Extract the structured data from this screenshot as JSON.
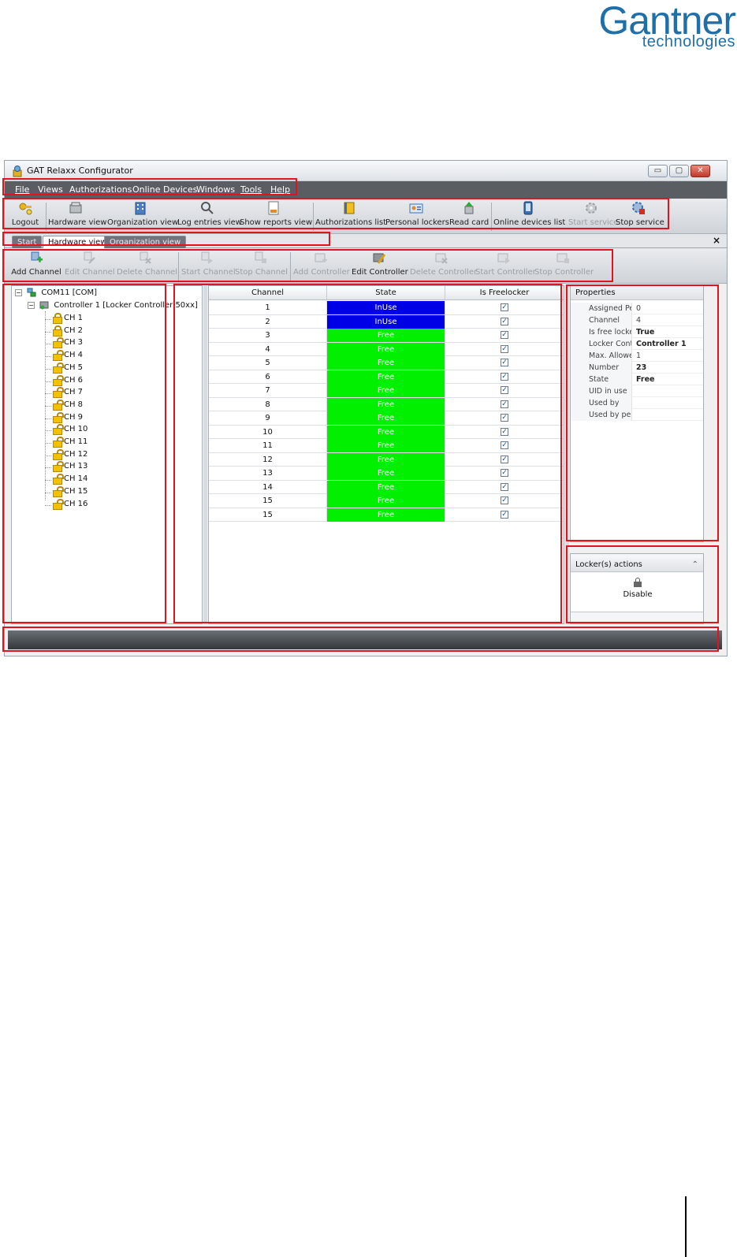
{
  "logo": {
    "word": "Gantner",
    "sub": "technologies"
  },
  "window": {
    "title": "GAT Relaxx Configurator",
    "buttons": {
      "minimize": "▭",
      "maximize": "▢",
      "close": "✕"
    }
  },
  "menu": {
    "items": [
      {
        "label": "File",
        "underline": "F"
      },
      {
        "label": "Views"
      },
      {
        "label": "Authorizations"
      },
      {
        "label": "Online Devices"
      },
      {
        "label": "Windows"
      },
      {
        "label": "Tools",
        "underline": "T"
      },
      {
        "label": "Help",
        "underline": "H"
      }
    ]
  },
  "toolbar": {
    "logout": "Logout",
    "hardware_view": "Hardware view",
    "organization_view": "Organization view",
    "log_entries_view": "Log entries view",
    "show_reports_view": "Show reports view",
    "authorizations_list": "Authorizations list",
    "personal_lockers": "Personal lockers",
    "read_card": "Read card",
    "online_devices_list": "Online devices list",
    "start_service": "Start service",
    "stop_service": "Stop service"
  },
  "tabs": {
    "start": "Start",
    "hardware_view": "Hardware view",
    "organization_view": "Organization view",
    "close": "×"
  },
  "toolbar2": {
    "add_channel": "Add Channel",
    "edit_channel": "Edit Channel",
    "delete_channel": "Delete Channel",
    "start_channel": "Start Channel",
    "stop_channel": "Stop Channel",
    "add_controller": "Add Controller",
    "edit_controller": "Edit Controller",
    "delete_controller": "Delete Controller",
    "start_controller": "Start Controller",
    "stop_controller": "Stop Controller"
  },
  "tree": {
    "root": "COM11 [COM]",
    "controller": "Controller 1 [Locker Controller 50xx]",
    "channels": [
      "CH 1",
      "CH 2",
      "CH 3",
      "CH 4",
      "CH 5",
      "CH 6",
      "CH 7",
      "CH 8",
      "CH 9",
      "CH 10",
      "CH 11",
      "CH 12",
      "CH 13",
      "CH 14",
      "CH 15",
      "CH 16"
    ],
    "expand_symbol": "−"
  },
  "grid": {
    "columns": [
      "Channel",
      "State",
      "Is Freelocker"
    ],
    "rows": [
      {
        "channel": "1",
        "state": "InUse",
        "freelocker": "✓"
      },
      {
        "channel": "2",
        "state": "InUse",
        "freelocker": "✓"
      },
      {
        "channel": "3",
        "state": "Free",
        "freelocker": "✓"
      },
      {
        "channel": "4",
        "state": "Free",
        "freelocker": "✓"
      },
      {
        "channel": "5",
        "state": "Free",
        "freelocker": "✓"
      },
      {
        "channel": "6",
        "state": "Free",
        "freelocker": "✓"
      },
      {
        "channel": "7",
        "state": "Free",
        "freelocker": "✓"
      },
      {
        "channel": "8",
        "state": "Free",
        "freelocker": "✓"
      },
      {
        "channel": "9",
        "state": "Free",
        "freelocker": "✓"
      },
      {
        "channel": "10",
        "state": "Free",
        "freelocker": "✓"
      },
      {
        "channel": "11",
        "state": "Free",
        "freelocker": "✓"
      },
      {
        "channel": "12",
        "state": "Free",
        "freelocker": "✓"
      },
      {
        "channel": "13",
        "state": "Free",
        "freelocker": "✓"
      },
      {
        "channel": "14",
        "state": "Free",
        "freelocker": "✓"
      },
      {
        "channel": "15",
        "state": "Free",
        "freelocker": "✓"
      },
      {
        "channel": "15",
        "state": "Free",
        "freelocker": "✓"
      }
    ],
    "state_colors": {
      "InUse": "#0000e6",
      "Free": "#00f000"
    }
  },
  "properties": {
    "header": "Properties",
    "rows": [
      {
        "key": "Assigned Per",
        "value": "0",
        "bold": false
      },
      {
        "key": "Channel",
        "value": "4",
        "bold": false
      },
      {
        "key": "Is free locker",
        "value": "True",
        "bold": true
      },
      {
        "key": "Locker Contr",
        "value": "Controller 1",
        "bold": true
      },
      {
        "key": "Max. Allowec",
        "value": "1",
        "bold": false
      },
      {
        "key": "Number",
        "value": "23",
        "bold": true
      },
      {
        "key": "State",
        "value": "Free",
        "bold": true
      },
      {
        "key": "UID in use",
        "value": "",
        "bold": false
      },
      {
        "key": "Used by",
        "value": "",
        "bold": false
      },
      {
        "key": "Used by pers",
        "value": "",
        "bold": false
      }
    ]
  },
  "actions": {
    "header": "Locker(s) actions",
    "chevron": "⌃",
    "disable": "Disable"
  },
  "colors": {
    "accent_annotation": "#e0141e",
    "logo": "#1f6fa8",
    "menubar": "#5a5e63"
  }
}
